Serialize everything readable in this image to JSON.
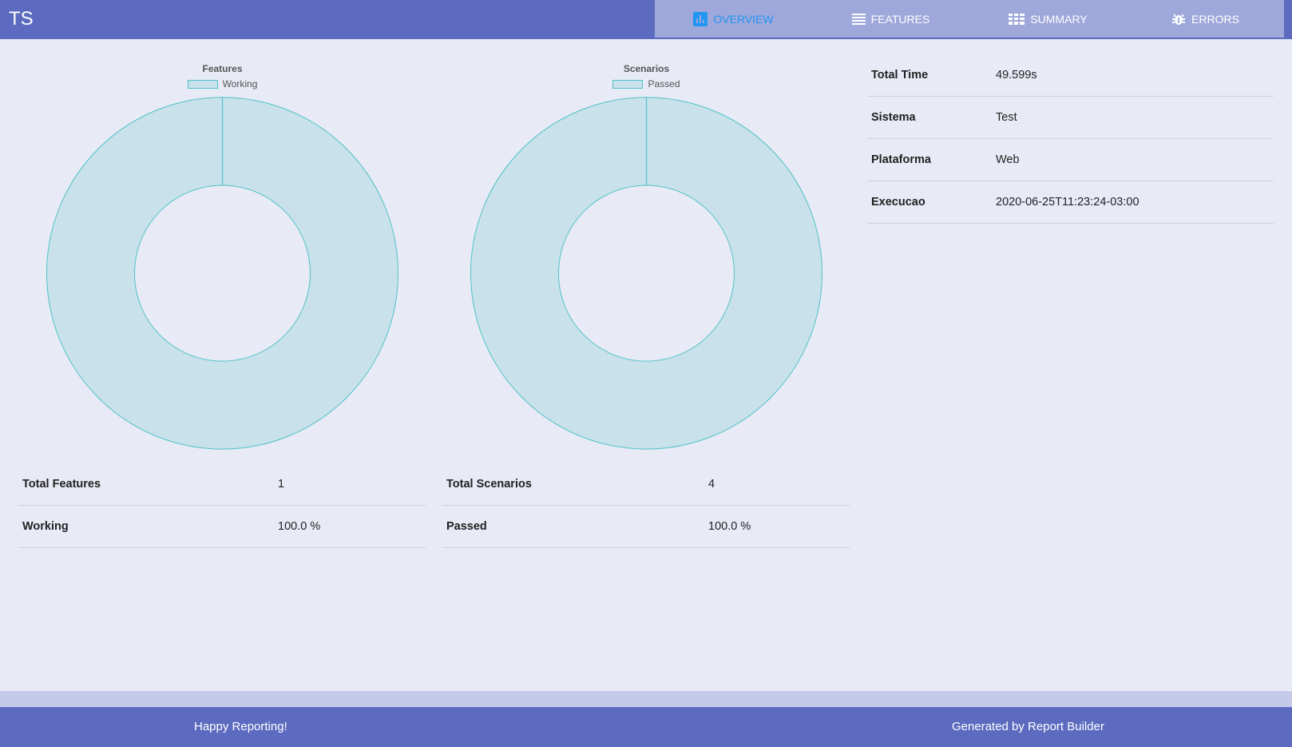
{
  "header": {
    "brand": "TS",
    "tabs": [
      {
        "label": "OVERVIEW",
        "icon": "bar-chart-icon",
        "active": true
      },
      {
        "label": "FEATURES",
        "icon": "list-icon",
        "active": false
      },
      {
        "label": "SUMMARY",
        "icon": "table-icon",
        "active": false
      },
      {
        "label": "ERRORS",
        "icon": "bug-icon",
        "active": false
      }
    ]
  },
  "features_chart": {
    "title": "Features",
    "legend": "Working",
    "stats": [
      {
        "label": "Total Features",
        "value": "1"
      },
      {
        "label": "Working",
        "value": "100.0 %"
      }
    ]
  },
  "scenarios_chart": {
    "title": "Scenarios",
    "legend": "Passed",
    "stats": [
      {
        "label": "Total Scenarios",
        "value": "4"
      },
      {
        "label": "Passed",
        "value": "100.0 %"
      }
    ]
  },
  "chart_data": [
    {
      "type": "pie",
      "title": "Features",
      "categories": [
        "Working"
      ],
      "values": [
        1
      ],
      "legend": "top",
      "colors": {
        "fill": "#c9e1ea",
        "stroke": "#4fc3c8"
      }
    },
    {
      "type": "pie",
      "title": "Scenarios",
      "categories": [
        "Passed"
      ],
      "values": [
        4
      ],
      "legend": "top",
      "colors": {
        "fill": "#c9e1ea",
        "stroke": "#4fc3c8"
      }
    }
  ],
  "metadata": [
    {
      "label": "Total Time",
      "value": "49.599s"
    },
    {
      "label": "Sistema",
      "value": "Test"
    },
    {
      "label": "Plataforma",
      "value": "Web"
    },
    {
      "label": "Execucao",
      "value": "2020-06-25T11:23:24-03:00"
    }
  ],
  "footer": {
    "left": "Happy Reporting!",
    "right": "Generated by Report Builder"
  },
  "colors": {
    "header": "#5c6bc0",
    "tabs_bg": "#9fa8da",
    "active_tab": "#2196f3",
    "page_bg": "#e8eaf6"
  }
}
